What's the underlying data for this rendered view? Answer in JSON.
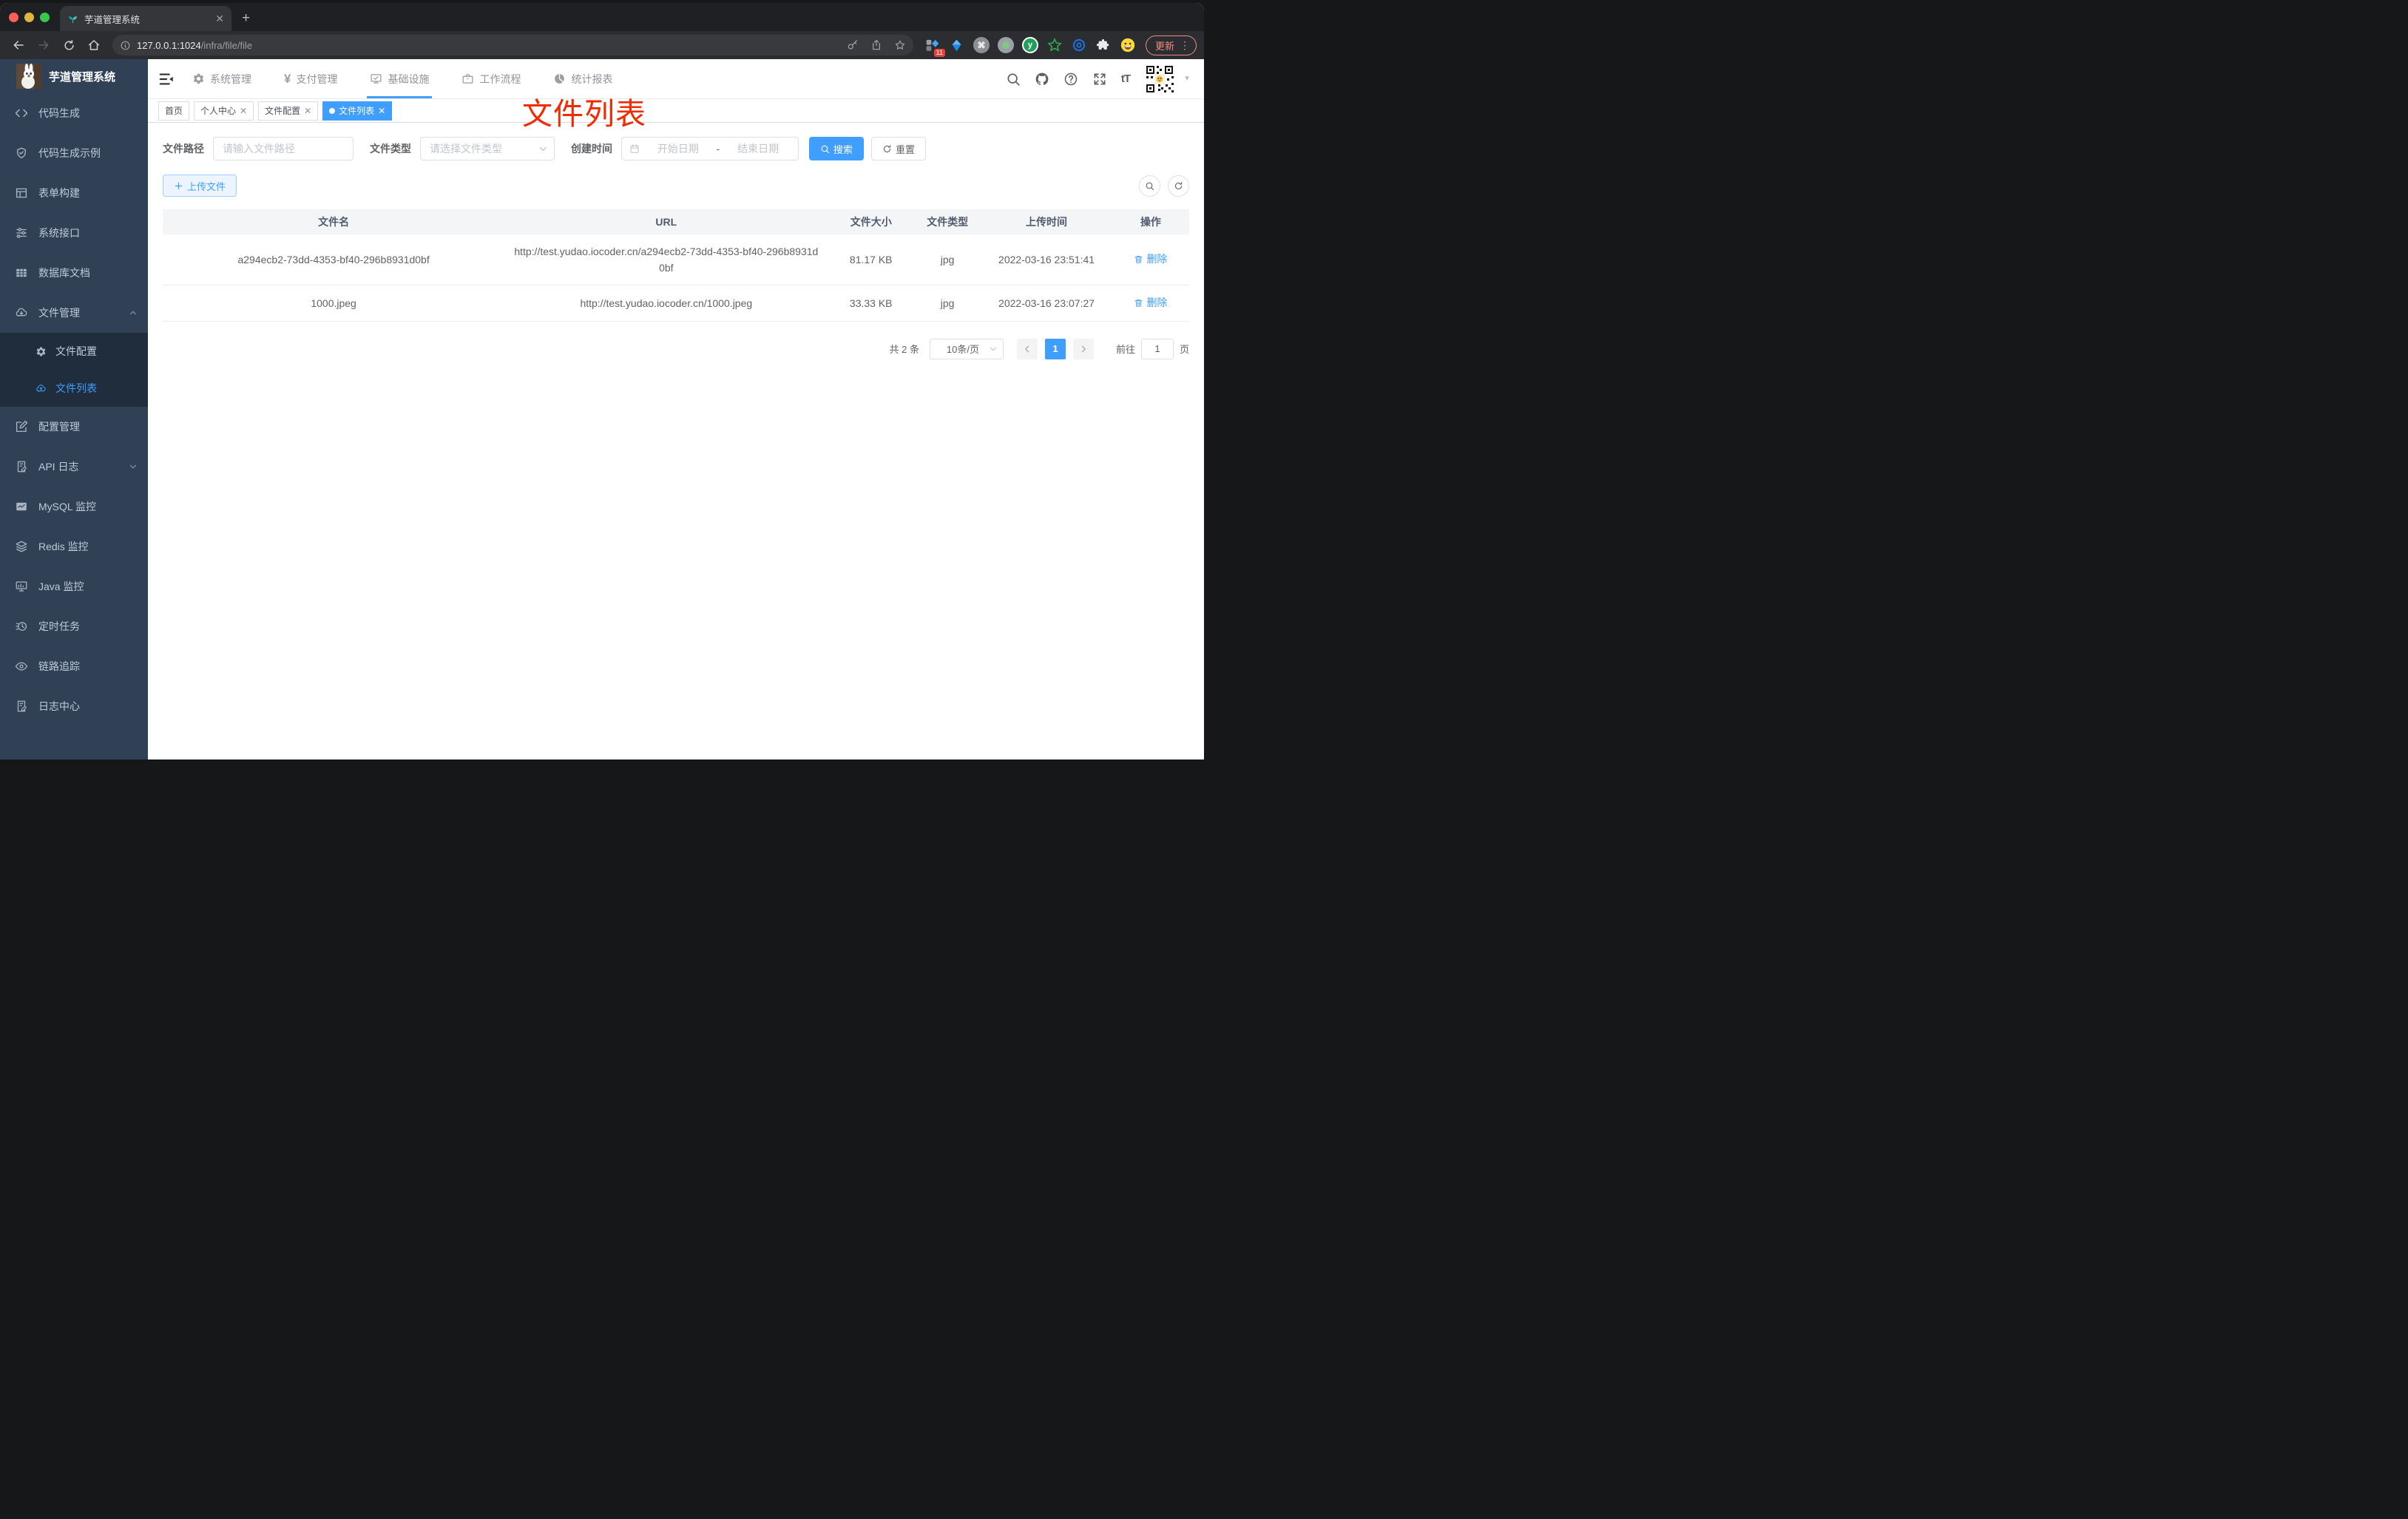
{
  "colors": {
    "accent": "#409eff",
    "sidebar_bg": "#304156",
    "submenu_bg": "#1f2d3d",
    "annotation_red": "#f12b00",
    "tag_active": "#409eff"
  },
  "browser": {
    "tab_title": "芋道管理系统",
    "url_host": "127.0.0.1:1024",
    "url_path": "/infra/file/file",
    "update_label": "更新",
    "menu_dots": "⋮",
    "extensions": [
      {
        "name": "blue-diamond-extension",
        "badge": "11"
      },
      {
        "name": "kite-extension"
      },
      {
        "name": "command-extension",
        "glyph": "⌘"
      },
      {
        "name": "green-dot-extension"
      },
      {
        "name": "y-extension",
        "glyph": "y"
      },
      {
        "name": "green-star-extension"
      },
      {
        "name": "blue-rings-extension"
      },
      {
        "name": "puzzle-extensions-button"
      },
      {
        "name": "profile-emoji-avatar"
      }
    ]
  },
  "header": {
    "nav": [
      {
        "label": "系统管理"
      },
      {
        "label": "支付管理",
        "icon_char": "¥"
      },
      {
        "label": "基础设施",
        "active": true
      },
      {
        "label": "工作流程"
      },
      {
        "label": "统计报表"
      }
    ],
    "font_size_icon_label": "tT"
  },
  "sidebar": {
    "title": "芋道管理系统",
    "items": [
      {
        "label": "代码生成"
      },
      {
        "label": "代码生成示例"
      },
      {
        "label": "表单构建"
      },
      {
        "label": "系统接口"
      },
      {
        "label": "数据库文档"
      },
      {
        "label": "文件管理",
        "expanded": true,
        "children": [
          {
            "label": "文件配置"
          },
          {
            "label": "文件列表",
            "active": true
          }
        ]
      },
      {
        "label": "配置管理"
      },
      {
        "label": "API 日志",
        "collapsed": true
      },
      {
        "label": "MySQL 监控"
      },
      {
        "label": "Redis 监控"
      },
      {
        "label": "Java 监控"
      },
      {
        "label": "定时任务"
      },
      {
        "label": "链路追踪"
      },
      {
        "label": "日志中心"
      }
    ]
  },
  "tags": [
    {
      "label": "首页",
      "closable": false
    },
    {
      "label": "个人中心",
      "closable": true
    },
    {
      "label": "文件配置",
      "closable": true
    },
    {
      "label": "文件列表",
      "closable": true,
      "active": true
    }
  ],
  "annotation": {
    "text": "文件列表"
  },
  "filters": {
    "path_label": "文件路径",
    "path_placeholder": "请输入文件路径",
    "type_label": "文件类型",
    "type_placeholder": "请选择文件类型",
    "time_label": "创建时间",
    "start_placeholder": "开始日期",
    "range_separator": "-",
    "end_placeholder": "结束日期",
    "search_label": "搜索",
    "reset_label": "重置"
  },
  "toolbar": {
    "upload_label": "上传文件"
  },
  "table": {
    "headers": [
      "文件名",
      "URL",
      "文件大小",
      "文件类型",
      "上传时间",
      "操作"
    ],
    "rows": [
      {
        "name": "a294ecb2-73dd-4353-bf40-296b8931d0bf",
        "url": "http://test.yudao.iocoder.cn/a294ecb2-73dd-4353-bf40-296b8931d0bf",
        "size": "81.17 KB",
        "type": "jpg",
        "time": "2022-03-16 23:51:41",
        "action": "删除"
      },
      {
        "name": "1000.jpeg",
        "url": "http://test.yudao.iocoder.cn/1000.jpeg",
        "size": "33.33 KB",
        "type": "jpg",
        "time": "2022-03-16 23:07:27",
        "action": "删除"
      }
    ]
  },
  "pagination": {
    "total_label": "共 2 条",
    "page_size_label": "10条/页",
    "current_page": "1",
    "goto_label": "前往",
    "goto_value": "1",
    "unit_label": "页"
  }
}
